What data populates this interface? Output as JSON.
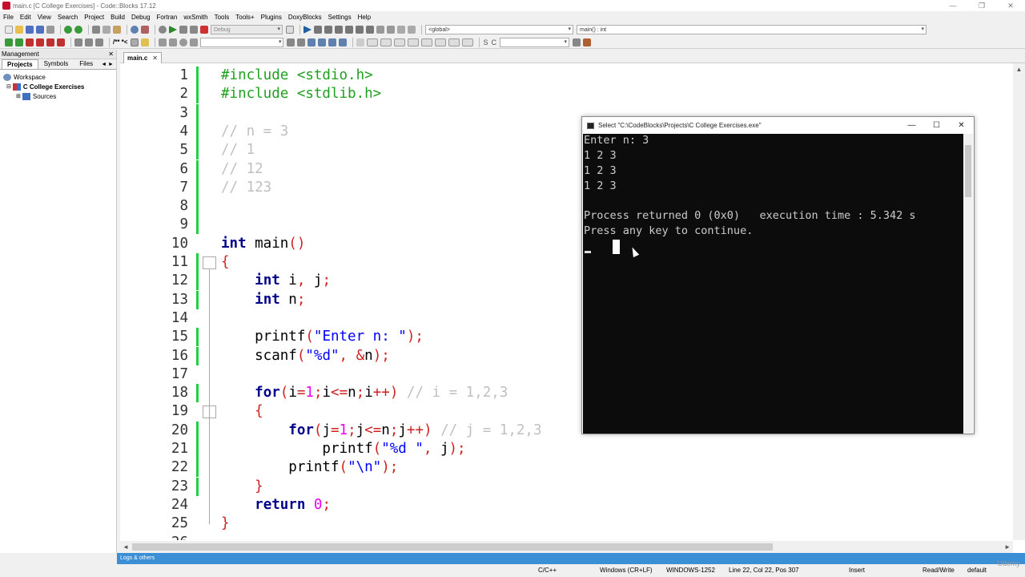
{
  "window": {
    "title": "main.c [C College Exercises] - Code::Blocks 17.12",
    "controls": [
      "—",
      "❐",
      "✕"
    ]
  },
  "menu": [
    "File",
    "Edit",
    "View",
    "Search",
    "Project",
    "Build",
    "Debug",
    "Fortran",
    "wxSmith",
    "Tools",
    "Tools+",
    "Plugins",
    "DoxyBlocks",
    "Settings",
    "Help"
  ],
  "toolbar": {
    "build_target": "Debug",
    "scope": "<global>",
    "symbol": "main() : int",
    "doxy_comment": "/** *<"
  },
  "management": {
    "title": "Management",
    "tabs": [
      "Projects",
      "Symbols",
      "Files"
    ],
    "nav": "◄ ►",
    "tree": [
      {
        "label": "Workspace",
        "level": 0
      },
      {
        "label": "C College Exercises",
        "level": 1,
        "bold": true
      },
      {
        "label": "Sources",
        "level": 2
      }
    ]
  },
  "editor": {
    "tab": "main.c",
    "lines": [
      {
        "n": "1",
        "html": "<span class='pp'>#include &lt;stdio.h&gt;</span>"
      },
      {
        "n": "2",
        "html": "<span class='pp'>#include &lt;stdlib.h&gt;</span>"
      },
      {
        "n": "3",
        "html": ""
      },
      {
        "n": "4",
        "html": "<span class='cm'>// n = 3</span>"
      },
      {
        "n": "5",
        "html": "<span class='cm'>// 1</span>"
      },
      {
        "n": "6",
        "html": "<span class='cm'>// 12</span>"
      },
      {
        "n": "7",
        "html": "<span class='cm'>// 123</span>"
      },
      {
        "n": "8",
        "html": ""
      },
      {
        "n": "9",
        "html": ""
      },
      {
        "n": "10",
        "html": "<span class='kw'>int</span> main<span class='op'>()</span>"
      },
      {
        "n": "11",
        "html": "<span class='op'>{</span>"
      },
      {
        "n": "12",
        "html": "    <span class='kw'>int</span> i<span class='op'>,</span> j<span class='op'>;</span>"
      },
      {
        "n": "13",
        "html": "    <span class='kw'>int</span> n<span class='op'>;</span>"
      },
      {
        "n": "14",
        "html": ""
      },
      {
        "n": "15",
        "html": "    printf<span class='op'>(</span><span class='st'>\"Enter n: \"</span><span class='op'>);</span>"
      },
      {
        "n": "16",
        "html": "    scanf<span class='op'>(</span><span class='st'>\"%d\"</span><span class='op'>,</span> <span class='op'>&amp;</span>n<span class='op'>);</span>"
      },
      {
        "n": "17",
        "html": ""
      },
      {
        "n": "18",
        "html": "    <span class='kw'>for</span><span class='op'>(</span>i<span class='op'>=</span><span class='nm'>1</span><span class='op'>;</span>i<span class='op'>&lt;=</span>n<span class='op'>;</span>i<span class='op'>++)</span> <span class='cm'>// i = 1,2,3</span>"
      },
      {
        "n": "19",
        "html": "    <span class='op'>{</span>"
      },
      {
        "n": "20",
        "html": "        <span class='kw'>for</span><span class='op'>(</span>j<span class='op'>=</span><span class='nm'>1</span><span class='op'>;</span>j<span class='op'>&lt;=</span>n<span class='op'>;</span>j<span class='op'>++)</span> <span class='cm'>// j = 1,2,3</span>"
      },
      {
        "n": "21",
        "html": "            printf<span class='op'>(</span><span class='st'>\"%d \"</span><span class='op'>,</span> j<span class='op'>);</span>"
      },
      {
        "n": "22",
        "html": "        printf<span class='op'>(</span><span class='st'>\"\\n\"</span><span class='op'>);</span>"
      },
      {
        "n": "23",
        "html": "    <span class='op'>}</span>"
      },
      {
        "n": "24",
        "html": "    <span class='kw'>return</span> <span class='nm'>0</span><span class='op'>;</span>"
      },
      {
        "n": "25",
        "html": "<span class='op'>}</span>"
      },
      {
        "n": "26",
        "html": ""
      }
    ]
  },
  "logs": {
    "label": "Logs & others"
  },
  "status": {
    "language": "C/C++",
    "eol": "Windows (CR+LF)",
    "encoding": "WINDOWS-1252",
    "position": "Line 22, Col 22, Pos 307",
    "mode": "Insert",
    "access": "Read/Write",
    "profile": "default"
  },
  "console": {
    "title": "Select \"C:\\CodeBlocks\\Projects\\C College Exercises.exe\"",
    "controls": [
      "—",
      "☐",
      "✕"
    ],
    "lines": [
      "Enter n: 3",
      "1 2 3",
      "1 2 3",
      "1 2 3",
      "",
      "Process returned 0 (0x0)   execution time : 5.342 s",
      "Press any key to continue."
    ]
  },
  "watermark": "Udemy",
  "colors": {
    "keyword": "#00008b",
    "preprocessor": "#20a020",
    "comment": "#c0c0c0",
    "string": "#0000ff",
    "operator": "#d02020",
    "number": "#ee00ee",
    "change_marker": "#20d040",
    "logs_bar": "#3b8fd4"
  }
}
